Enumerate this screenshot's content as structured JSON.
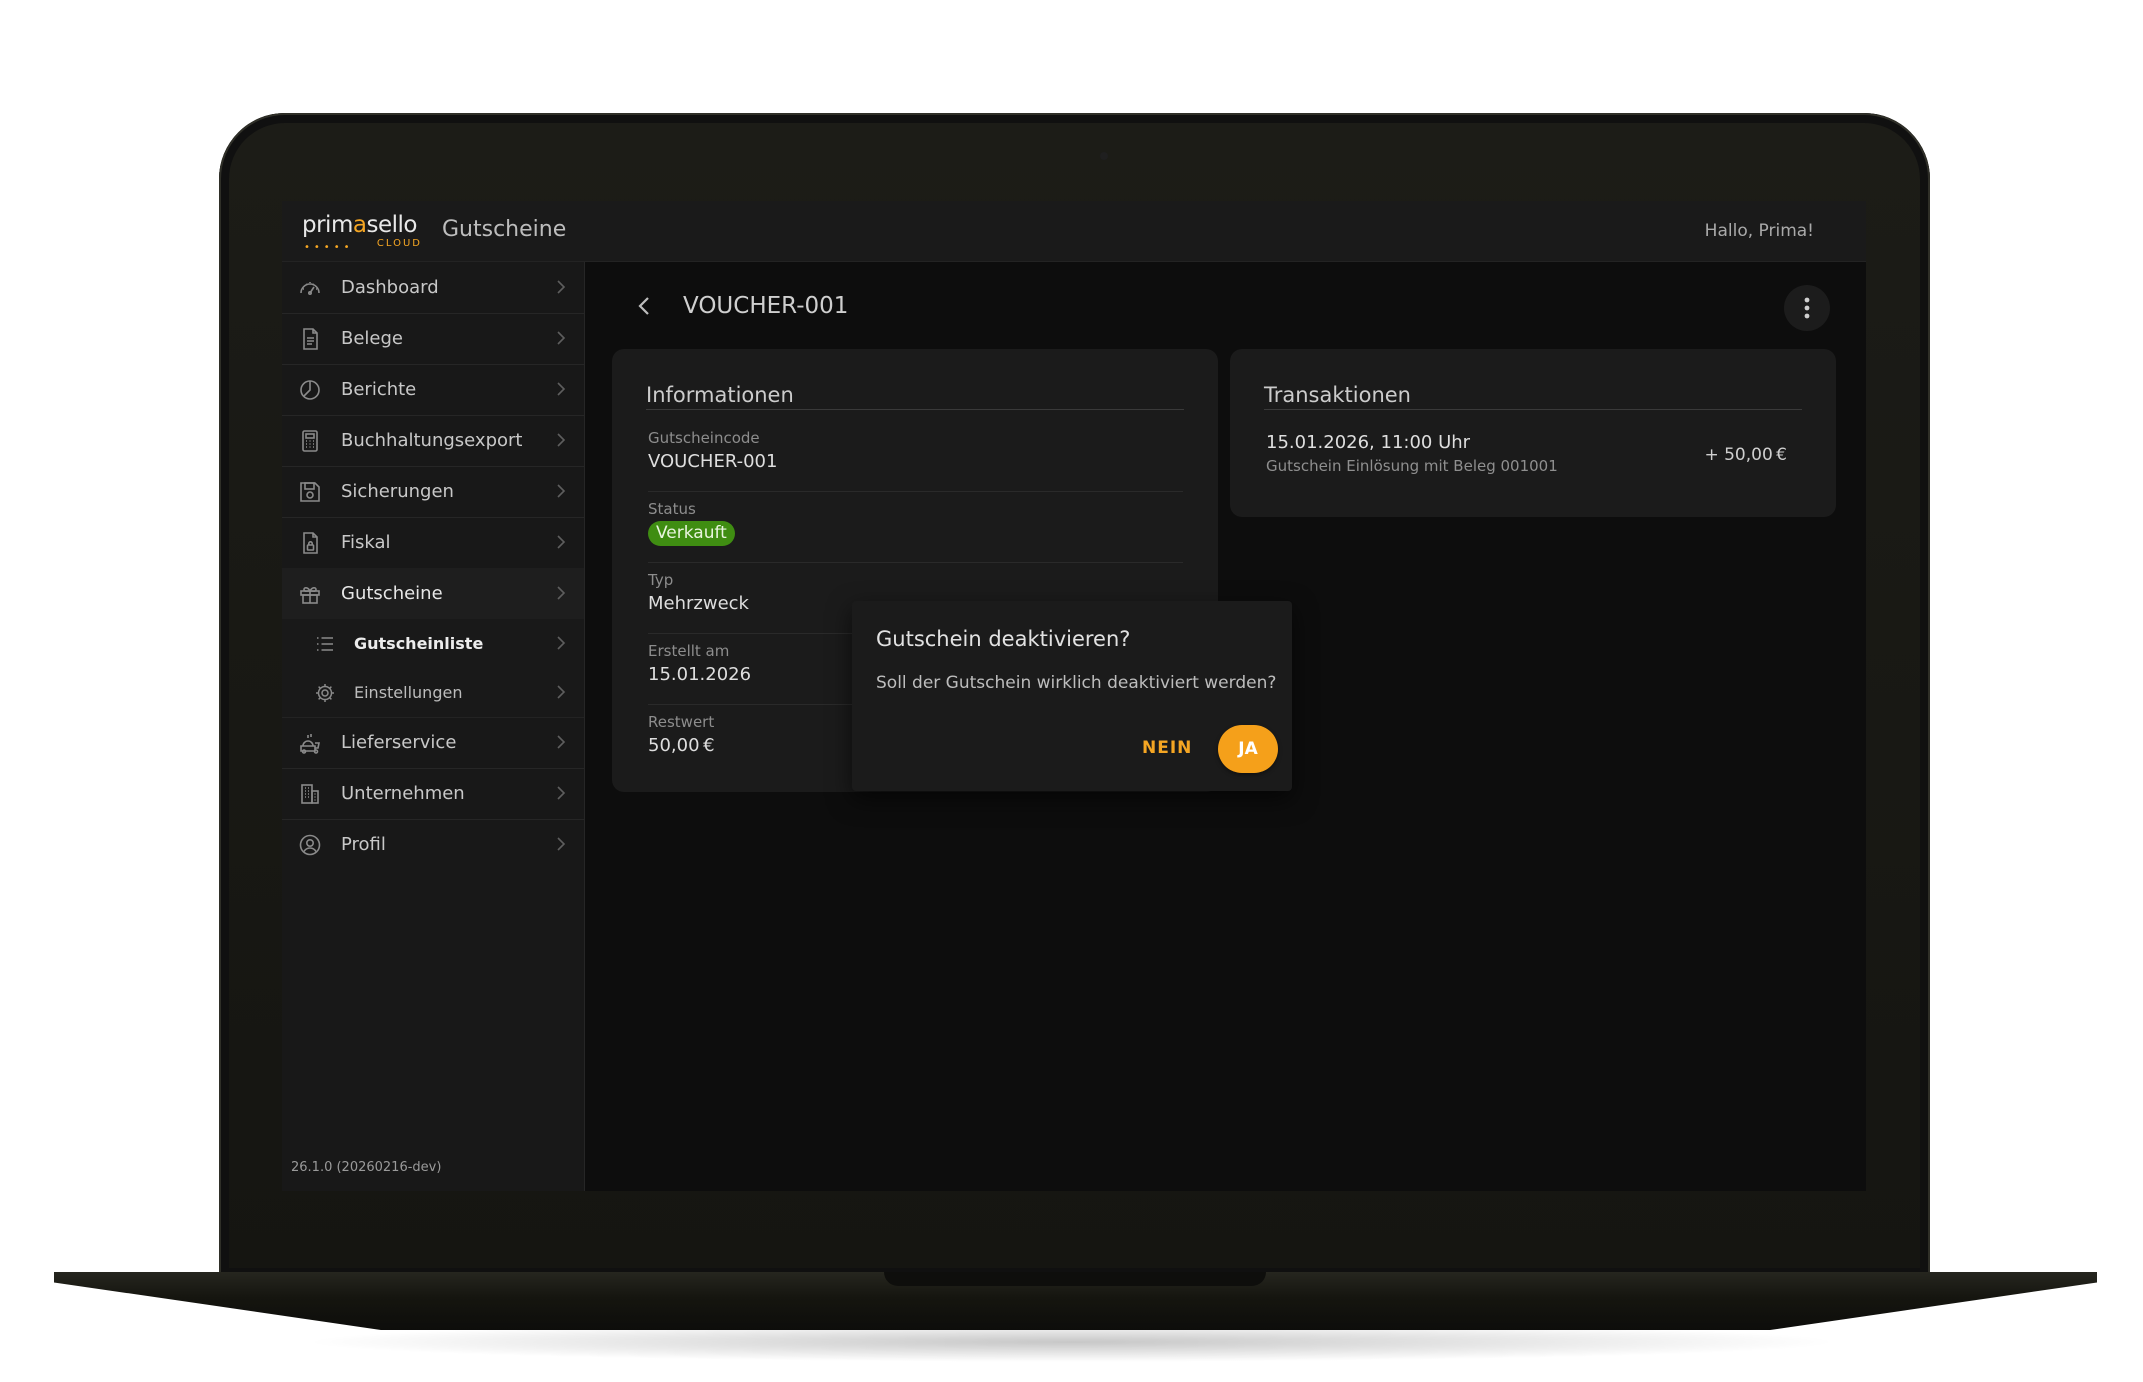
{
  "header": {
    "logo_word_1": "prim",
    "logo_word_a": "a",
    "logo_word_2": "sello",
    "logo_sub": "CLOUD",
    "app_title": "Gutscheine",
    "greeting": "Hallo, Prima!"
  },
  "sidebar": {
    "items": [
      {
        "label": "Dashboard",
        "icon": "dashboard-icon"
      },
      {
        "label": "Belege",
        "icon": "document-icon"
      },
      {
        "label": "Berichte",
        "icon": "pie-chart-icon"
      },
      {
        "label": "Buchhaltungsexport",
        "icon": "calculator-icon"
      },
      {
        "label": "Sicherungen",
        "icon": "save-icon"
      },
      {
        "label": "Fiskal",
        "icon": "fiscal-document-icon"
      },
      {
        "label": "Gutscheine",
        "icon": "gift-icon"
      },
      {
        "label": "Lieferservice",
        "icon": "delivery-icon"
      },
      {
        "label": "Unternehmen",
        "icon": "building-icon"
      },
      {
        "label": "Profil",
        "icon": "user-circle-icon"
      }
    ],
    "sub_items": [
      {
        "label": "Gutscheinliste",
        "icon": "list-icon"
      },
      {
        "label": "Einstellungen",
        "icon": "gear-icon"
      }
    ],
    "version": "26.1.0 (20260216-dev)"
  },
  "main": {
    "title": "VOUCHER-001",
    "info": {
      "title": "Informationen",
      "fields": [
        {
          "key": "Gutscheincode",
          "value": "VOUCHER-001"
        },
        {
          "key": "Status",
          "value": "Verkauft"
        },
        {
          "key": "Typ",
          "value": "Mehrzweck"
        },
        {
          "key": "Erstellt am",
          "value": "15.01.2026"
        },
        {
          "key": "Restwert",
          "value": "50,00 €"
        }
      ]
    },
    "transactions": {
      "title": "Transaktionen",
      "items": [
        {
          "date": "15.01.2026, 11:00 Uhr",
          "description": "Gutschein Einlösung mit Beleg 001001",
          "amount": "+ 50,00 €"
        }
      ]
    }
  },
  "dialog": {
    "title": "Gutschein deaktivieren?",
    "text": "Soll der Gutschein wirklich deaktiviert werden?",
    "no_label": "NEIN",
    "yes_label": "JA"
  },
  "colors": {
    "accent": "#f5a623",
    "status_green": "#3f8d12",
    "background": "#0d0d0d"
  }
}
